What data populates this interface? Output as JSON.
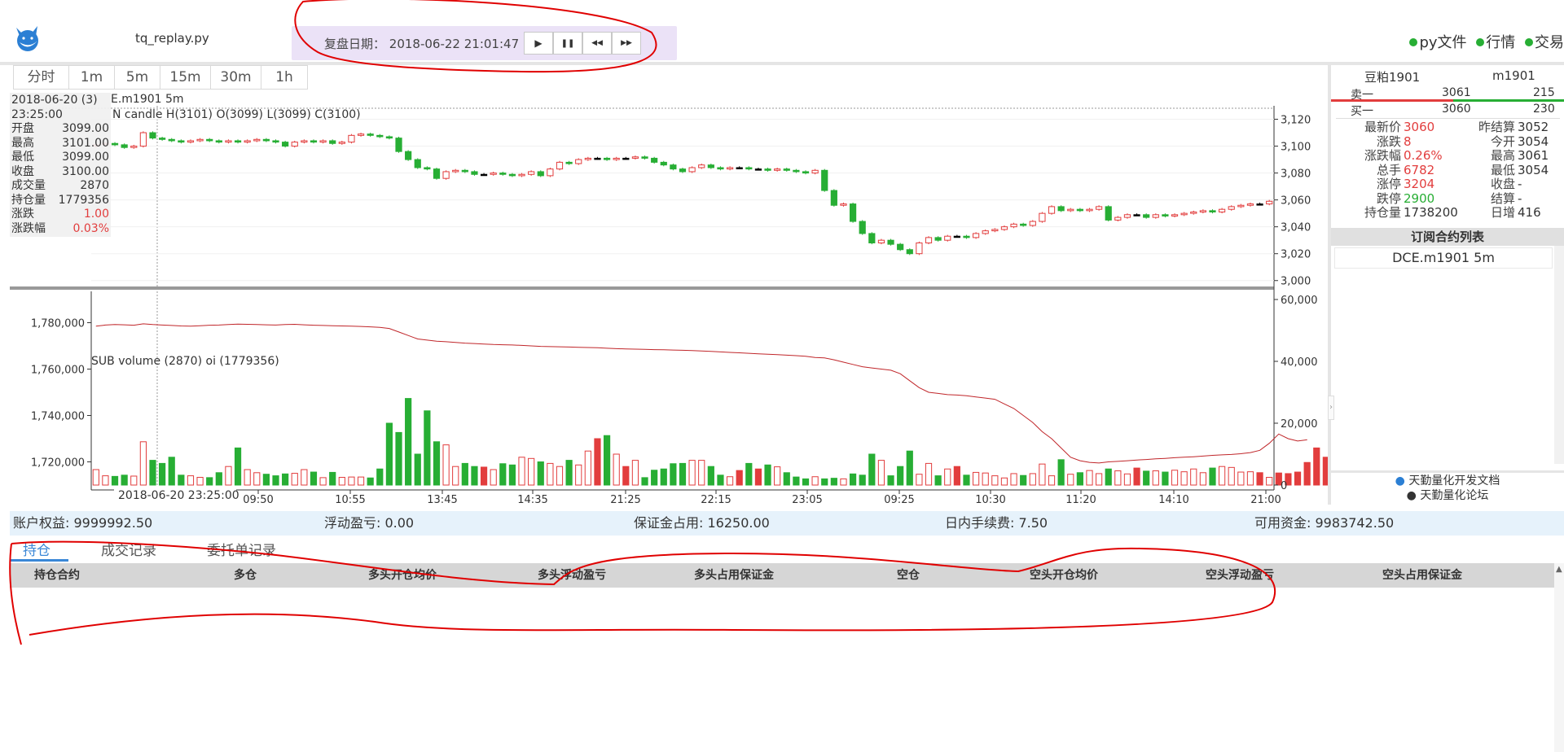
{
  "header": {
    "app_title": "tq_replay.py",
    "replay_label": "复盘日期：",
    "replay_datetime": "2018-06-22 21:01:47 (-)",
    "buttons": [
      "▶",
      "❚❚",
      "◀◀",
      "▶▶"
    ],
    "links": [
      "py文件",
      "行情",
      "交易"
    ]
  },
  "period_tabs": [
    "分时",
    "1m",
    "5m",
    "15m",
    "30m",
    "1h"
  ],
  "chart": {
    "main_title_fragment": "E.m1901 5m",
    "candle_label": "N candle H(3101) O(3099) L(3099) C(3100)",
    "sub_label": "SUB volume (2870) oi (1779356)",
    "crosshair_label": "2018-06-20 23:25:00",
    "price_ticks": [
      "3,120",
      "3,100",
      "3,080",
      "3,060",
      "3,040",
      "3,020",
      "3,000"
    ],
    "volume_ticks": [
      "60,000",
      "40,000",
      "20,000",
      "0"
    ],
    "oi_ticks": [
      "1,780,000",
      "1,760,000",
      "1,740,000",
      "1,720,000"
    ],
    "time_ticks": [
      "09:50",
      "10:55",
      "13:45",
      "14:35",
      "21:25",
      "22:15",
      "23:05",
      "09:25",
      "10:30",
      "11:20",
      "14:10",
      "21:00"
    ]
  },
  "chart_data": {
    "type": "candlestick",
    "symbol": "DCE.m1901",
    "period": "5m",
    "close": [
      3101,
      3102,
      3101,
      3099,
      3100,
      3110,
      3106,
      3105,
      3104,
      3103,
      3104,
      3105,
      3104,
      3103,
      3104,
      3103,
      3104,
      3105,
      3104,
      3103,
      3100,
      3103,
      3104,
      3103,
      3104,
      3102,
      3103,
      3108,
      3109,
      3108,
      3107,
      3106,
      3096,
      3090,
      3084,
      3083,
      3076,
      3081,
      3082,
      3081,
      3079,
      3079,
      3080,
      3079,
      3078,
      3079,
      3081,
      3078,
      3083,
      3088,
      3087,
      3090,
      3091,
      3091,
      3090,
      3091,
      3091,
      3092,
      3091,
      3088,
      3086,
      3083,
      3081,
      3084,
      3086,
      3084,
      3083,
      3084,
      3084,
      3083,
      3083,
      3082,
      3083,
      3082,
      3081,
      3080,
      3082,
      3067,
      3056,
      3057,
      3044,
      3035,
      3028,
      3030,
      3027,
      3023,
      3020,
      3028,
      3032,
      3030,
      3033,
      3033,
      3032,
      3035,
      3037,
      3038,
      3040,
      3042,
      3041,
      3044,
      3050,
      3055,
      3052,
      3053,
      3052,
      3053,
      3055,
      3045,
      3047,
      3049,
      3049,
      3047,
      3049,
      3048,
      3049,
      3050,
      3051,
      3052,
      3051,
      3053,
      3055,
      3056,
      3057,
      3057,
      3059
    ],
    "volume": [
      5000,
      3000,
      2800,
      3200,
      2900,
      14000,
      8000,
      7000,
      9000,
      3200,
      3000,
      2500,
      2400,
      4000,
      6000,
      12000,
      5000,
      4000,
      3500,
      3000,
      3600,
      3800,
      5000,
      4200,
      2400,
      4100,
      2500,
      2600,
      2600,
      2300,
      5200,
      20000,
      17000,
      28000,
      10000,
      24000,
      14000,
      13000,
      6000,
      7000,
      6000,
      5800,
      5000,
      6900,
      6500,
      9000,
      8600,
      7500,
      7000,
      6000,
      8000,
      6500,
      11000,
      15000,
      16000,
      10000,
      6000,
      8000,
      2400,
      4800,
      5200,
      6900,
      7000,
      8000,
      8000,
      6000,
      3200,
      2700,
      4700,
      7000,
      5200,
      6500,
      5900,
      4000,
      2600,
      2000,
      2700,
      2000,
      2200,
      2000,
      3600,
      3200,
      10000,
      8000,
      3000,
      6000,
      11000,
      3500,
      7000,
      3000,
      5200,
      6000,
      3200,
      4100,
      3900,
      3000,
      2300,
      3700,
      3100,
      3700,
      6800,
      3000,
      8200,
      3500,
      4000,
      4700,
      3700,
      5200,
      4600,
      3600,
      5500,
      4500,
      4600,
      4200,
      4800,
      4300,
      5200,
      4000,
      5500,
      6000,
      5700,
      4200,
      4300,
      4000,
      2500,
      3900,
      3700,
      4200,
      7300,
      12000,
      9000,
      5000
    ],
    "oi": [
      1778500,
      1779000,
      1779200,
      1779100,
      1778900,
      1779500,
      1779200,
      1779000,
      1778800,
      1778600,
      1778500,
      1778700,
      1778900,
      1779000,
      1779200,
      1779400,
      1779300,
      1779200,
      1779100,
      1779000,
      1779200,
      1779300,
      1779100,
      1778900,
      1778800,
      1778700,
      1778600,
      1778500,
      1778400,
      1778200,
      1778000,
      1777500,
      1776000,
      1774500,
      1773000,
      1772500,
      1772000,
      1771800,
      1771500,
      1771200,
      1771000,
      1770800,
      1770600,
      1770500,
      1770400,
      1770200,
      1770000,
      1769800,
      1769700,
      1769600,
      1769500,
      1769400,
      1769300,
      1769200,
      1769000,
      1768800,
      1768700,
      1768600,
      1768500,
      1768400,
      1768300,
      1768200,
      1768100,
      1768000,
      1767800,
      1767600,
      1767400,
      1767200,
      1767000,
      1766800,
      1766600,
      1766400,
      1766200,
      1766000,
      1765800,
      1765500,
      1765000,
      1764800,
      1764000,
      1763000,
      1762000,
      1761000,
      1760500,
      1760000,
      1759500,
      1758000,
      1755000,
      1752000,
      1750000,
      1749500,
      1749000,
      1748800,
      1748500,
      1748000,
      1747500,
      1747000,
      1745000,
      1743000,
      1740000,
      1737000,
      1733000,
      1730000,
      1726000,
      1722000,
      1720500,
      1719800,
      1719500,
      1720000,
      1720200,
      1720500,
      1720800,
      1721000,
      1721300,
      1721500,
      1721800,
      1722000,
      1722200,
      1722500,
      1722800,
      1723000,
      1723200,
      1723500,
      1724000,
      1725000,
      1728000,
      1732000,
      1730000,
      1729000,
      1729500
    ],
    "ylim_price": [
      2995,
      3130
    ],
    "ylim_volume": [
      0,
      60000
    ],
    "ylim_oi": [
      1710000,
      1790000
    ]
  },
  "info_box": {
    "date": "2018-06-20 (3)",
    "time": "23:25:00",
    "rows": [
      {
        "label": "开盘",
        "value": "3099.00",
        "tone": "normal"
      },
      {
        "label": "最高",
        "value": "3101.00",
        "tone": "normal"
      },
      {
        "label": "最低",
        "value": "3099.00",
        "tone": "normal"
      },
      {
        "label": "收盘",
        "value": "3100.00",
        "tone": "normal"
      },
      {
        "label": "成交量",
        "value": "2870",
        "tone": "normal"
      },
      {
        "label": "持仓量",
        "value": "1779356",
        "tone": "normal"
      },
      {
        "label": "涨跌",
        "value": "1.00",
        "tone": "red"
      },
      {
        "label": "涨跌幅",
        "value": "0.03%",
        "tone": "red"
      }
    ]
  },
  "quote": {
    "name": "豆粕1901",
    "code": "m1901",
    "ask_label": "卖一",
    "ask_price": "3061",
    "ask_volume": "215",
    "bid_label": "买一",
    "bid_price": "3060",
    "bid_volume": "230",
    "stats": [
      {
        "l1": "最新价",
        "v1": "3060",
        "c1": "red",
        "l2": "昨结算",
        "v2": "3052"
      },
      {
        "l1": "涨跌",
        "v1": "8",
        "c1": "red",
        "l2": "今开",
        "v2": "3054"
      },
      {
        "l1": "涨跌幅",
        "v1": "0.26%",
        "c1": "red",
        "l2": "最高",
        "v2": "3061"
      },
      {
        "l1": "总手",
        "v1": "6782",
        "c1": "red",
        "l2": "最低",
        "v2": "3054"
      },
      {
        "l1": "涨停",
        "v1": "3204",
        "c1": "red",
        "l2": "收盘",
        "v2": "-"
      },
      {
        "l1": "跌停",
        "v1": "2900",
        "c1": "green",
        "l2": "结算",
        "v2": "-"
      },
      {
        "l1": "持仓量",
        "v1": "1738200",
        "c1": "normal",
        "l2": "日增",
        "v2": "416"
      }
    ]
  },
  "subscriptions": {
    "title": "订阅合约列表",
    "items": [
      "DCE.m1901 5m"
    ]
  },
  "doc_links": [
    "天勤量化开发文档",
    "天勤量化论坛"
  ],
  "account": {
    "equity": "账户权益: 9999992.50",
    "float_pnl": "浮动盈亏: 0.00",
    "margin": "保证金占用: 16250.00",
    "commission": "日内手续费: 7.50",
    "available": "可用资金: 9983742.50"
  },
  "bottom_tabs": [
    "持仓",
    "成交记录",
    "委托单记录"
  ],
  "positions_table": {
    "columns": [
      "持仓合约",
      "多仓",
      "多头开仓均价",
      "多头浮动盈亏",
      "多头占用保证金",
      "空仓",
      "空头开仓均价",
      "空头浮动盈亏",
      "空头占用保证金"
    ]
  },
  "colors": {
    "up": "#e23d3d",
    "down": "#27ae34",
    "annotation": "#e00000",
    "replay_bg": "#ebe2f7",
    "status_bg": "#e6f2fb"
  }
}
